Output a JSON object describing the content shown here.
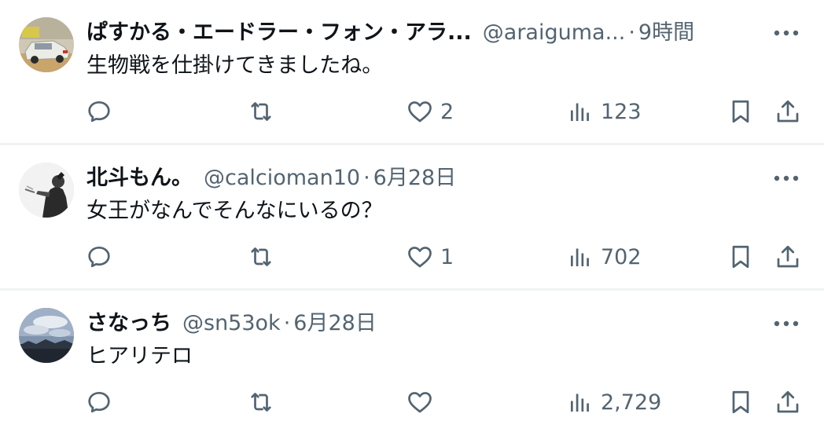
{
  "tweets": [
    {
      "display_name": "ぱすかる・エードラー・フォン・アラ...",
      "handle": "@araiguma...",
      "separator": "·",
      "time": "9時間",
      "text": "生物戦を仕掛けてきましたね。",
      "reply_count": "",
      "retweet_count": "",
      "like_count": "2",
      "view_count": "123",
      "avatar": "toy-car-photo"
    },
    {
      "display_name": "北斗もん。",
      "handle": "@calcioman10",
      "separator": "·",
      "time": "6月28日",
      "text": "女王がなんでそんなにいるの？",
      "reply_count": "",
      "retweet_count": "",
      "like_count": "1",
      "view_count": "702",
      "avatar": "monochrome-figure-photo"
    },
    {
      "display_name": "さなっち",
      "handle": "@sn53ok",
      "separator": "·",
      "time": "6月28日",
      "text": "ヒアリテロ",
      "reply_count": "",
      "retweet_count": "",
      "like_count": "",
      "view_count": "2,729",
      "avatar": "cloudy-sky-photo"
    }
  ],
  "icons": {
    "more": "more-horizontal-icon",
    "reply": "reply-icon",
    "retweet": "retweet-icon",
    "like": "heart-icon",
    "views": "views-bar-chart-icon",
    "bookmark": "bookmark-icon",
    "share": "share-icon"
  },
  "colors": {
    "primary_text": "#0f1419",
    "secondary_text": "#536471",
    "divider": "#eff3f4",
    "background": "#ffffff"
  }
}
